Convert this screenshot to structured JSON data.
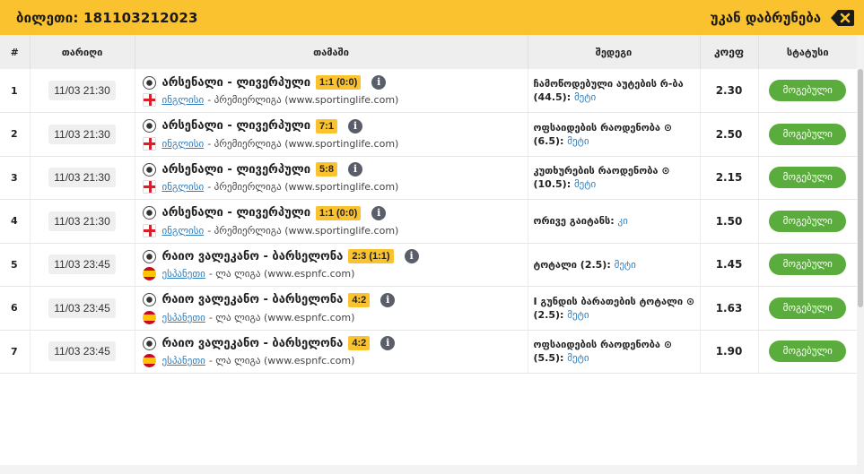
{
  "header": {
    "ticket_title": "ბილეთი: 181103212023",
    "back_label": "უკან დაბრუნება",
    "back_icon": "backspace-close-icon"
  },
  "columns": [
    "#",
    "თარიღი",
    "თამაში",
    "შედეგი",
    "კოეფ",
    "სტატუსი"
  ],
  "rows": [
    {
      "num": "1",
      "date": "11/03 21:30",
      "match": "არსენალი - ლივერპული",
      "score": "1:1 (0:0)",
      "flag": "england",
      "country": "ინგლისი",
      "league_rest": "- პრემიერლიგა (www.sportinglife.com)",
      "bet": "ჩამოწოდებული აუტების რ-ბა (44.5):",
      "pick": "მეტი",
      "odd": "2.30",
      "status": "მოგებული"
    },
    {
      "num": "2",
      "date": "11/03 21:30",
      "match": "არსენალი - ლივერპული",
      "score": "7:1",
      "flag": "england",
      "country": "ინგლისი",
      "league_rest": "- პრემიერლიგა (www.sportinglife.com)",
      "bet": "ოფსაიდების რაოდენობა ⊙ (6.5):",
      "pick": "მეტი",
      "odd": "2.50",
      "status": "მოგებული"
    },
    {
      "num": "3",
      "date": "11/03 21:30",
      "match": "არსენალი - ლივერპული",
      "score": "5:8",
      "flag": "england",
      "country": "ინგლისი",
      "league_rest": "- პრემიერლიგა (www.sportinglife.com)",
      "bet": "კუთხურების რაოდენობა ⊙ (10.5):",
      "pick": "მეტი",
      "odd": "2.15",
      "status": "მოგებული"
    },
    {
      "num": "4",
      "date": "11/03 21:30",
      "match": "არსენალი - ლივერპული",
      "score": "1:1 (0:0)",
      "flag": "england",
      "country": "ინგლისი",
      "league_rest": "- პრემიერლიგა (www.sportinglife.com)",
      "bet": "ორივე გაიტანს:",
      "pick": "კი",
      "odd": "1.50",
      "status": "მოგებული"
    },
    {
      "num": "5",
      "date": "11/03 23:45",
      "match": "რაიო ვალეკანო - ბარსელონა",
      "score": "2:3 (1:1)",
      "flag": "spain",
      "country": "ესპანეთი",
      "league_rest": "- ლა ლიგა (www.espnfc.com)",
      "bet": "ტოტალი (2.5):",
      "pick": "მეტი",
      "odd": "1.45",
      "status": "მოგებული"
    },
    {
      "num": "6",
      "date": "11/03 23:45",
      "match": "რაიო ვალეკანო - ბარსელონა",
      "score": "4:2",
      "flag": "spain",
      "country": "ესპანეთი",
      "league_rest": "- ლა ლიგა (www.espnfc.com)",
      "bet": "I გუნდის ბარათების ტოტალი ⊙ (2.5):",
      "pick": "მეტი",
      "odd": "1.63",
      "status": "მოგებული"
    },
    {
      "num": "7",
      "date": "11/03 23:45",
      "match": "რაიო ვალეკანო - ბარსელონა",
      "score": "4:2",
      "flag": "spain",
      "country": "ესპანეთი",
      "league_rest": "- ლა ლიგა (www.espnfc.com)",
      "bet": "ოფსაიდების რაოდენობა ⊙ (5.5):",
      "pick": "მეტი",
      "odd": "1.90",
      "status": "მოგებული"
    }
  ],
  "colors": {
    "accent": "#f9c22e",
    "status_win": "#5aac3c",
    "link": "#2e7dbd"
  }
}
